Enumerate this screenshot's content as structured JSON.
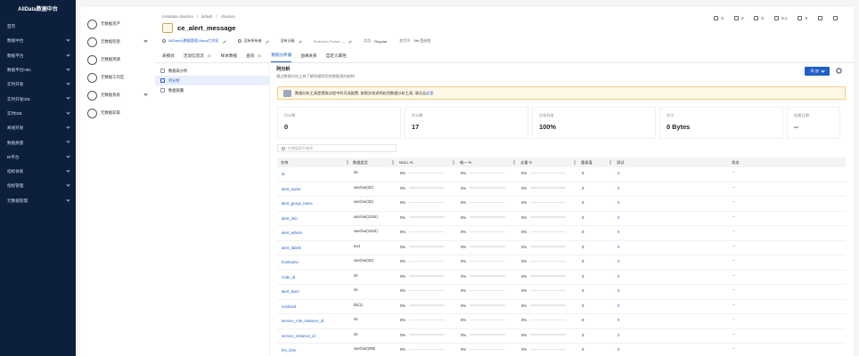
{
  "app": {
    "brand": "AllData数据中台",
    "nav": [
      {
        "label": "首页",
        "chev": false
      },
      {
        "label": "数据中台",
        "chev": true
      },
      {
        "label": "数据平台",
        "chev": true
      },
      {
        "label": "数据平台H8s",
        "chev": true
      },
      {
        "label": "实时开发",
        "chev": true
      },
      {
        "label": "实时开发IDE",
        "chev": true
      },
      {
        "label": "实时IDE",
        "chev": true
      },
      {
        "label": "离线开发",
        "chev": true
      },
      {
        "label": "数据质量",
        "chev": true
      },
      {
        "label": "BI平台",
        "chev": true
      },
      {
        "label": "指标体系",
        "chev": true
      },
      {
        "label": "指标管理",
        "chev": true
      },
      {
        "label": "元数据管理",
        "chev": true
      }
    ]
  },
  "subnav": [
    {
      "label": "元数据资产",
      "chev": false
    },
    {
      "label": "元数据检索",
      "chev": true
    },
    {
      "label": "元数据溯源",
      "chev": false
    },
    {
      "label": "元数据工作区",
      "chev": false
    },
    {
      "label": "元数据系统",
      "chev": true
    },
    {
      "label": "元数据获取",
      "chev": false
    }
  ],
  "breadcrumb": [
    "metadata.cloudera",
    "/",
    "default",
    "/",
    "cloudera"
  ],
  "title": "ce_alert_message",
  "meta": {
    "owner_link": "AllData元数据管理-Mysql工作区",
    "no_owner": "没有所有者",
    "no_class": "没有分级",
    "retention_label": "Retention Period",
    "retention_value": "--",
    "type_label": "类型:",
    "type_value": "Regular",
    "usage_label": "使用率:",
    "usage_value": "0th 百分位"
  },
  "actions": [
    {
      "icon": "thumb-up-icon",
      "value": "0"
    },
    {
      "icon": "thumb-down-icon",
      "value": "0"
    },
    {
      "icon": "comment-icon",
      "value": "0"
    },
    {
      "icon": "history-icon",
      "value": "0.1"
    },
    {
      "icon": "star-icon",
      "value": "0"
    },
    {
      "icon": "share-icon",
      "value": ""
    },
    {
      "icon": "more-icon",
      "value": ""
    }
  ],
  "tabs": [
    {
      "label": "表模式",
      "count": ""
    },
    {
      "label": "活动信息流",
      "count": "3"
    },
    {
      "label": "样本数据",
      "count": ""
    },
    {
      "label": "查询",
      "count": "0"
    },
    {
      "label": "数据分析器",
      "count": ""
    },
    {
      "label": "血缘关系",
      "count": ""
    },
    {
      "label": "自定义属性",
      "count": ""
    }
  ],
  "active_tab_index": 4,
  "tree": [
    {
      "label": "数据表分析"
    },
    {
      "label": "列分析"
    },
    {
      "label": "数据质量"
    }
  ],
  "active_tree_index": 1,
  "panel": {
    "title": "列分析",
    "subtitle": "通过数据分析工具了解和跟踪您的数据表的结构",
    "add_label": "添 加",
    "tip_text": "数据分析工具是提取过程中的可选配置, 按照文档说明启用数据分析工具, 请点击",
    "tip_link": "这里"
  },
  "stats": [
    {
      "label": "行计数",
      "value": "0"
    },
    {
      "label": "列计数",
      "value": "17"
    },
    {
      "label": "分析样本",
      "value": "100%"
    },
    {
      "label": "大小",
      "value": "0 Bytes"
    },
    {
      "label": "创建日期",
      "value": "--"
    }
  ],
  "search_placeholder": "在数据表中查找",
  "columns": [
    "名称",
    "数据类型",
    "NULL %",
    "唯一 %",
    "去重 %",
    "重复值",
    "测试",
    "状态"
  ],
  "rows": [
    {
      "name": "id",
      "type": "int",
      "null": "0%",
      "uniq": "0%",
      "dist": "0%",
      "dup": "0",
      "test": "0",
      "status": "--"
    },
    {
      "name": "alert_name",
      "type": "varchar(32)",
      "null": "0%",
      "uniq": "0%",
      "dist": "0%",
      "dup": "0",
      "test": "0",
      "status": "--"
    },
    {
      "name": "alert_group_name",
      "type": "varchar(32)",
      "null": "0%",
      "uniq": "0%",
      "dist": "0%",
      "dup": "0",
      "test": "0",
      "status": "--"
    },
    {
      "name": "alert_info",
      "type": "varchar(1024)",
      "null": "0%",
      "uniq": "0%",
      "dist": "0%",
      "dup": "0",
      "test": "0",
      "status": "--"
    },
    {
      "name": "alert_advice",
      "type": "varchar(1024)",
      "null": "0%",
      "uniq": "0%",
      "dist": "0%",
      "dup": "0",
      "test": "0",
      "status": "--"
    },
    {
      "name": "alert_labels",
      "type": "text",
      "null": "0%",
      "uniq": "0%",
      "dist": "0%",
      "dup": "0",
      "test": "0",
      "status": "--"
    },
    {
      "name": "hostname",
      "type": "varchar(32)",
      "null": "0%",
      "uniq": "0%",
      "dist": "0%",
      "dup": "0",
      "test": "0",
      "status": "--"
    },
    {
      "name": "node_id",
      "type": "int",
      "null": "0%",
      "uniq": "0%",
      "dist": "0%",
      "dup": "0",
      "test": "0",
      "status": "--"
    },
    {
      "name": "alert_level",
      "type": "int",
      "null": "0%",
      "uniq": "0%",
      "dist": "0%",
      "dup": "0",
      "test": "0",
      "status": "--"
    },
    {
      "name": "resolved",
      "type": "bit(1)",
      "null": "0%",
      "uniq": "0%",
      "dist": "0%",
      "dup": "0",
      "test": "0",
      "status": "--"
    },
    {
      "name": "service_role_instance_id",
      "type": "int",
      "null": "0%",
      "uniq": "0%",
      "dist": "0%",
      "dup": "0",
      "test": "0",
      "status": "--"
    },
    {
      "name": "service_instance_id",
      "type": "int",
      "null": "0%",
      "uniq": "0%",
      "dist": "0%",
      "dup": "0",
      "test": "0",
      "status": "--"
    },
    {
      "name": "fire_time",
      "type": "varchar(255)",
      "null": "0%",
      "uniq": "0%",
      "dist": "0%",
      "dup": "0",
      "test": "0",
      "status": "--"
    }
  ]
}
